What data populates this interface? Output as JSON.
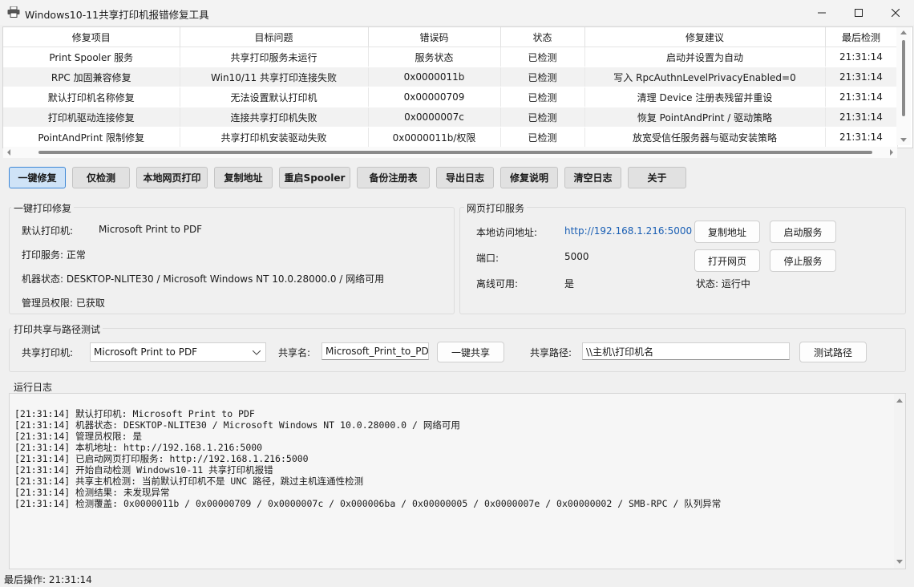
{
  "window": {
    "title": "Windows10-11共享打印机报错修复工具"
  },
  "table": {
    "headers": [
      "修复项目",
      "目标问题",
      "错误码",
      "状态",
      "修复建议",
      "最后检测"
    ],
    "rows": [
      [
        "Print Spooler 服务",
        "共享打印服务未运行",
        "服务状态",
        "已检测",
        "启动并设置为自动",
        "21:31:14"
      ],
      [
        "RPC 加固兼容修复",
        "Win10/11 共享打印连接失败",
        "0x0000011b",
        "已检测",
        "写入 RpcAuthnLevelPrivacyEnabled=0",
        "21:31:14"
      ],
      [
        "默认打印机名称修复",
        "无法设置默认打印机",
        "0x00000709",
        "已检测",
        "清理 Device 注册表残留并重设",
        "21:31:14"
      ],
      [
        "打印机驱动连接修复",
        "连接共享打印机失败",
        "0x0000007c",
        "已检测",
        "恢复 PointAndPrint / 驱动策略",
        "21:31:14"
      ],
      [
        "PointAndPrint 限制修复",
        "共享打印机安装驱动失败",
        "0x0000011b/权限",
        "已检测",
        "放宽受信任服务器与驱动安装策略",
        "21:31:14"
      ]
    ]
  },
  "toolbar": {
    "buttons": [
      "一键修复",
      "仅检测",
      "本地网页打印",
      "复制地址",
      "重启Spooler",
      "备份注册表",
      "导出日志",
      "修复说明",
      "清空日志",
      "关于"
    ]
  },
  "repair_group": {
    "title": "一键打印修复",
    "default_printer_label": "默认打印机:",
    "default_printer_value": "Microsoft Print to PDF",
    "print_service": "打印服务: 正常",
    "machine_status": "机器状态: DESKTOP-NLITE30 / Microsoft Windows NT 10.0.28000.0 / 网络可用",
    "admin_rights": "管理员权限: 已获取"
  },
  "web_group": {
    "title": "网页打印服务",
    "local_url_label": "本地访问地址:",
    "local_url": "http://192.168.1.216:5000",
    "port_label": "端口:",
    "port_value": "5000",
    "offline_label": "离线可用:",
    "offline_value": "是",
    "status_text": "状态: 运行中",
    "copy_button": "复制地址",
    "start_button": "启动服务",
    "open_button": "打开网页",
    "stop_button": "停止服务"
  },
  "share_group": {
    "title": "打印共享与路径测试",
    "printer_label": "共享打印机:",
    "printer_value": "Microsoft Print to PDF",
    "share_name_label": "共享名:",
    "share_name_value": "Microsoft_Print_to_PDF",
    "share_button": "一键共享",
    "path_label": "共享路径:",
    "path_value": "\\\\主机\\打印机名",
    "test_button": "测试路径"
  },
  "log": {
    "title": "运行日志",
    "lines": [
      "[21:31:14] 默认打印机: Microsoft Print to PDF",
      "[21:31:14] 机器状态: DESKTOP-NLITE30 / Microsoft Windows NT 10.0.28000.0 / 网络可用",
      "[21:31:14] 管理员权限: 是",
      "[21:31:14] 本机地址: http://192.168.1.216:5000",
      "[21:31:14] 已启动网页打印服务: http://192.168.1.216:5000",
      "[21:31:14] 开始自动检测 Windows10-11 共享打印机报错",
      "[21:31:14] 共享主机检测: 当前默认打印机不是 UNC 路径，跳过主机连通性检测",
      "[21:31:14] 检测结果: 未发现异常",
      "[21:31:14] 检测覆盖: 0x0000011b / 0x00000709 / 0x0000007c / 0x000006ba / 0x00000005 / 0x0000007e / 0x00000002 / SMB-RPC / 队列异常"
    ]
  },
  "statusbar": {
    "text": "最后操作: 21:31:14"
  },
  "colors": {
    "link": "#1a5fb4",
    "active_button": "#cfe3f7",
    "active_border": "#3d87d6"
  }
}
